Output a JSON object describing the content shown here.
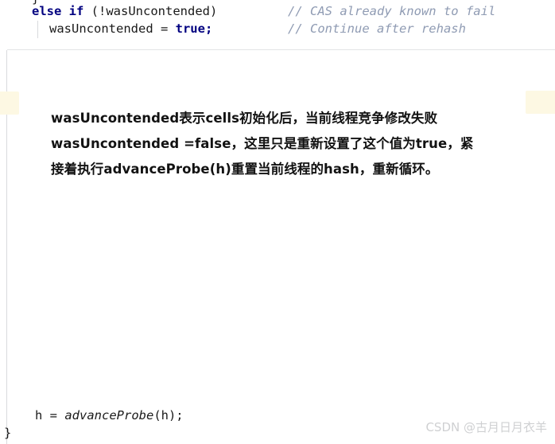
{
  "code_top": {
    "cut_line": "}",
    "line1": {
      "keyword1": "else",
      "keyword2": "if",
      "rest": " (!wasUncontended)",
      "comment": "// CAS already known to fail"
    },
    "line2": {
      "identifier": "wasUncontended = ",
      "keyword": "true",
      "terminator": ";",
      "comment": "// Continue after rehash"
    }
  },
  "note": {
    "line1": "wasUncontended表示cells初始化后，当前线程竞争修改失败",
    "line2": "wasUncontended =false，这里只是重新设置了这个值为true，紧",
    "line3": "接着执行advanceProbe(h)重置当前线程的hash，重新循环。"
  },
  "code_bottom": {
    "line1_prefix": "h = ",
    "line1_call": "advanceProbe",
    "line1_suffix": "(h);",
    "line2": "}"
  },
  "watermark": {
    "text": "CSDN @古月日月衣羊"
  },
  "colors": {
    "keyword": "#000080",
    "comment": "#8f9bb3",
    "marker_highlight": "#fdf8e3",
    "gutter": "#d9dadd",
    "watermark": "#cfd0d2",
    "body_text": "#121212"
  }
}
